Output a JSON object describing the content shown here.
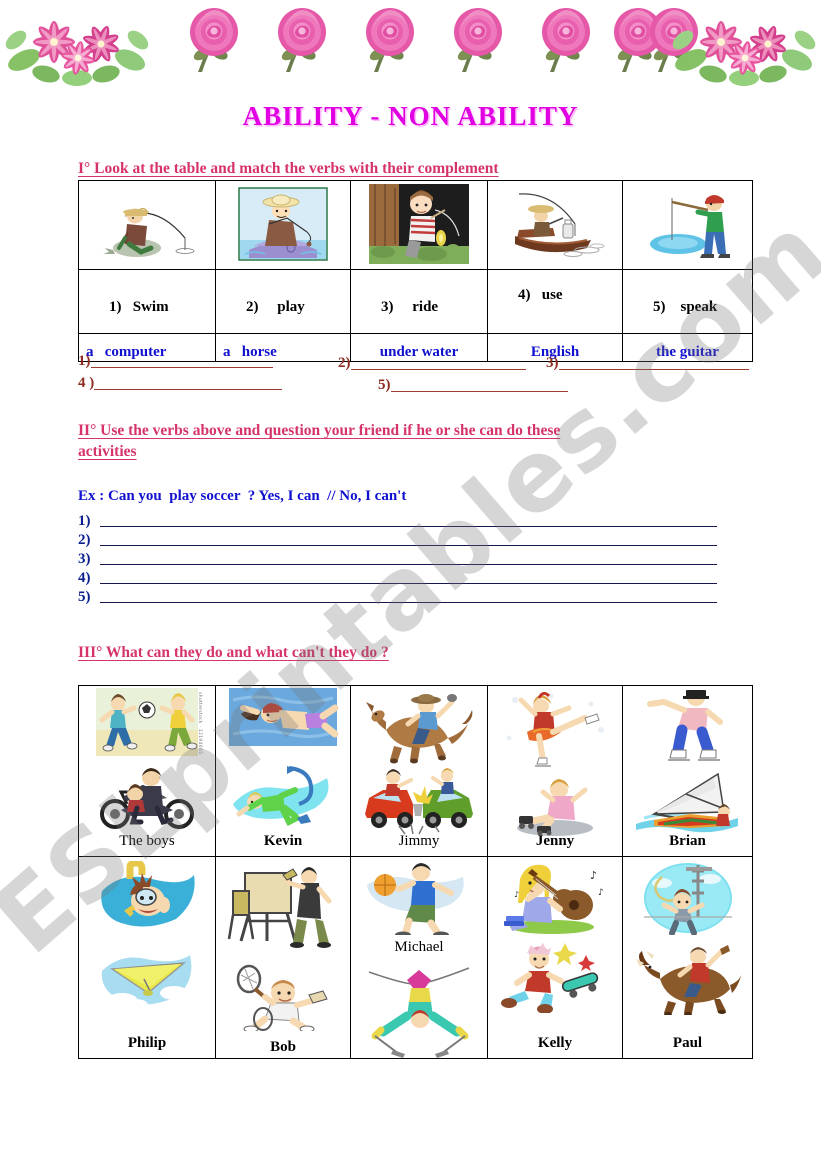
{
  "title": "ABILITY   -    NON ABILITY",
  "watermark": "ESLprintables.com",
  "decor": {
    "left_bouquet": "clematis-bouquet",
    "right_bouquet": "clematis-bouquet",
    "rose": "pink-rose",
    "rose_count": 7
  },
  "section1": {
    "heading": "I° Look at  the table and  match  the  verbs  with their complement",
    "verbs": [
      {
        "num": "1)",
        "verb": "Swim",
        "picture": "man-fishing-on-rock"
      },
      {
        "num": "2)",
        "verb": "play",
        "picture": "man-fishing-in-boat"
      },
      {
        "num": "3)",
        "verb": "ride",
        "picture": "boy-fishing-under-tree"
      },
      {
        "num": "4)",
        "verb": "use",
        "picture": "fisherman-in-canoe"
      },
      {
        "num": "5)",
        "verb": "speak",
        "picture": "boy-fishing-in-pond"
      }
    ],
    "complements": [
      "a   computer",
      "a   horse",
      "under water",
      "English",
      "the guitar"
    ],
    "answers": [
      "1)",
      "2)",
      "3)",
      "4 )",
      "5)"
    ]
  },
  "section2": {
    "heading_line1": "II° Use the verbs  above and question your friend if he or she can do these",
    "heading_line2": "activities",
    "example": "Ex : Can you  play soccer  ? Yes, I can  // No, I can't",
    "numbers": [
      "1)",
      "2)",
      "3)",
      "4)",
      "5)"
    ]
  },
  "section3": {
    "heading": "III° What   can  they  do   and what   can't  they   do  ?",
    "rows": [
      [
        {
          "name": "The  boys",
          "bold": false,
          "label_pos": "bottom",
          "art_top": "two-boys-playing-soccer",
          "art_bottom": "father-and-son-on-motorbike",
          "stock_code": "shutterstock · 12194665"
        },
        {
          "name": "Kevin",
          "bold": true,
          "label_pos": "bottom",
          "art_top": "man-swimming",
          "art_bottom": "boy-scuba-diving"
        },
        {
          "name": "Jimmy",
          "bold": false,
          "label_pos": "bottom",
          "art_top": "cowboy-riding-bucking-horse",
          "art_bottom": "car-crash-accident"
        },
        {
          "name": "Jenny",
          "bold": true,
          "label_pos": "bottom",
          "art_top": "figure-skater-spinning",
          "art_bottom": "girl-fallen-on-skates"
        },
        {
          "name": "Brian",
          "bold": true,
          "label_pos": "bottom",
          "art_top": "man-ice-skating",
          "art_bottom": "windsurfer-on-board"
        }
      ],
      [
        {
          "name": "Philip",
          "bold": true,
          "label_pos": "bottom",
          "art_top": "boy-snorkeling",
          "art_bottom": "hang-glider-in-sky"
        },
        {
          "name": "Bob",
          "bold": true,
          "label_pos": "bottom-low",
          "art_top": "artist-painting-at-easel",
          "art_bottom": "tennis-player-falling"
        },
        {
          "name": "Michael",
          "bold": false,
          "label_pos": "mid",
          "art_top": "basketball-player-dribbling",
          "art_bottom": "skier-doing-splits"
        },
        {
          "name": "Kelly",
          "bold": true,
          "label_pos": "bottom",
          "art_top": "girl-playing-guitar",
          "art_bottom": "boy-fallen-off-skateboard"
        },
        {
          "name": "Paul",
          "bold": true,
          "label_pos": "bottom",
          "art_top": "boy-bungee-jumping",
          "art_bottom": "cowboy-riding-bull"
        }
      ]
    ]
  },
  "colors": {
    "title": "#e100e1",
    "heading": "#d6336c",
    "complement_text": "#1010cf",
    "answer_rule_s1": "#9c3b2e",
    "answer_rule_s2": "#17174f"
  }
}
